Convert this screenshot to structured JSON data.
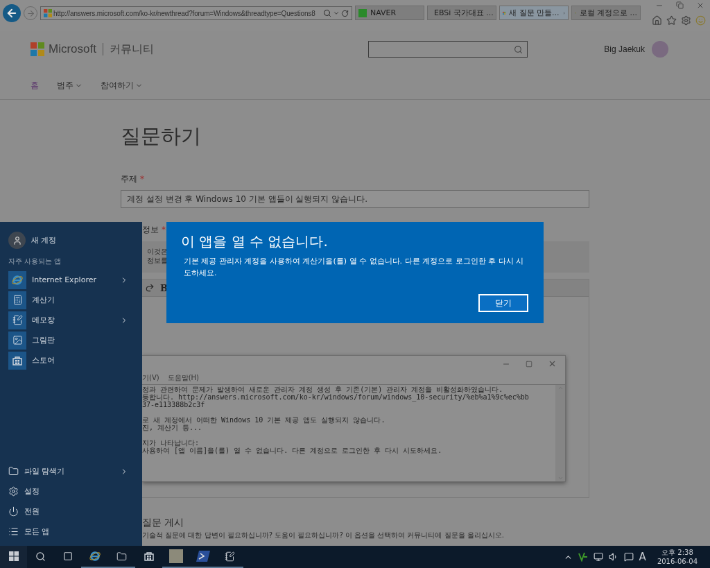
{
  "browser": {
    "address": "http://answers.microsoft.com/ko-kr/newthread?forum=Windows&threadtype=Questions8",
    "tabs": [
      {
        "kind": "naver",
        "label": "NAVER",
        "selected": false
      },
      {
        "kind": "ebsi",
        "label": "EBSi 국가대표 ...",
        "selected": false
      },
      {
        "kind": "ms",
        "label": "새 질문 만들...",
        "selected": true
      },
      {
        "kind": "ms",
        "label": "로컬 계정으로 ...",
        "selected": false
      }
    ]
  },
  "site": {
    "brand": "Microsoft",
    "section": "커뮤니티",
    "user": "Big Jaekuk",
    "nav": [
      {
        "label": "홈",
        "dropdown": false,
        "selected": true
      },
      {
        "label": "범주",
        "dropdown": true,
        "selected": false
      },
      {
        "label": "참여하기",
        "dropdown": true,
        "selected": false
      }
    ]
  },
  "form": {
    "title": "질문하기",
    "required_mark": "*",
    "subject_label": "주제",
    "subject_value": "계정 설정 변경 후 Windows 10 기본 앱들이 실행되지 않습니다.",
    "details_label": "정보",
    "info_lines": [
      "이것은",
      "정보를"
    ],
    "bold_button": "B",
    "post_title": "질문 게시",
    "post_description": "기술적 질문에 대한 답변이 필요하십니까? 도움이 필요하십니까? 이 옵션을 선택하여 커뮤니티에 질문을 올리십시오."
  },
  "notepad": {
    "menu": [
      "기(V)",
      "도움말(H)"
    ],
    "paragraphs": [
      [
        "정과 관련하여 문제가 발생하여 새로운 관리자 계정 생성 후 기존(기본) 관리자 계정을 비활성화하였습니다.",
        "등합니다. http://answers.microsoft.com/ko-kr/windows/forum/windows_10-security/%eb%a1%9c%ec%bb",
        "37-e113388b2c3f"
      ],
      [
        "로 새 계정에서 어떠한 Windows 10 기본 제공 앱도 실행되지 않습니다.",
        "진, 계산기 등..."
      ],
      [
        "지가 나타납니다:",
        "사용하여 [앱 이름]을(를) 열 수 없습니다. 다른 계정으로 로그인한 후 다시 시도하세요."
      ]
    ]
  },
  "dialog": {
    "title": "이 앱을 열 수 없습니다.",
    "message": "기본 제공 관리자 계정을 사용하여 계산기을(를) 열 수 없습니다. 다른 계정으로 로그인한 후 다시 시도하세요.",
    "button": "닫기"
  },
  "start_menu": {
    "user": "새 계정",
    "section": "자주 사용되는 앱",
    "apps": [
      {
        "kind": "ie",
        "label": "Internet Explorer",
        "has_submenu": true
      },
      {
        "kind": "calculator",
        "label": "계산기",
        "has_submenu": false
      },
      {
        "kind": "notepad",
        "label": "메모장",
        "has_submenu": true
      },
      {
        "kind": "paint",
        "label": "그림판",
        "has_submenu": false
      },
      {
        "kind": "store",
        "label": "스토어",
        "has_submenu": false
      }
    ],
    "system": [
      {
        "kind": "explorer",
        "label": "파일 탐색기",
        "has_submenu": true
      },
      {
        "kind": "settings",
        "label": "설정",
        "has_submenu": false
      },
      {
        "kind": "power",
        "label": "전원",
        "has_submenu": false
      },
      {
        "kind": "allapps",
        "label": "모든 앱",
        "has_submenu": false
      }
    ]
  },
  "taskbar": {
    "apps": [
      {
        "kind": "ie",
        "running": true
      },
      {
        "kind": "explorer",
        "running": true
      },
      {
        "kind": "store",
        "running": false
      },
      {
        "kind": "mu",
        "running": true
      },
      {
        "kind": "powershell",
        "running": true
      },
      {
        "kind": "notepad",
        "running": true
      }
    ],
    "ime": "A",
    "time": "오후 2:38",
    "date": "2016-06-04"
  }
}
